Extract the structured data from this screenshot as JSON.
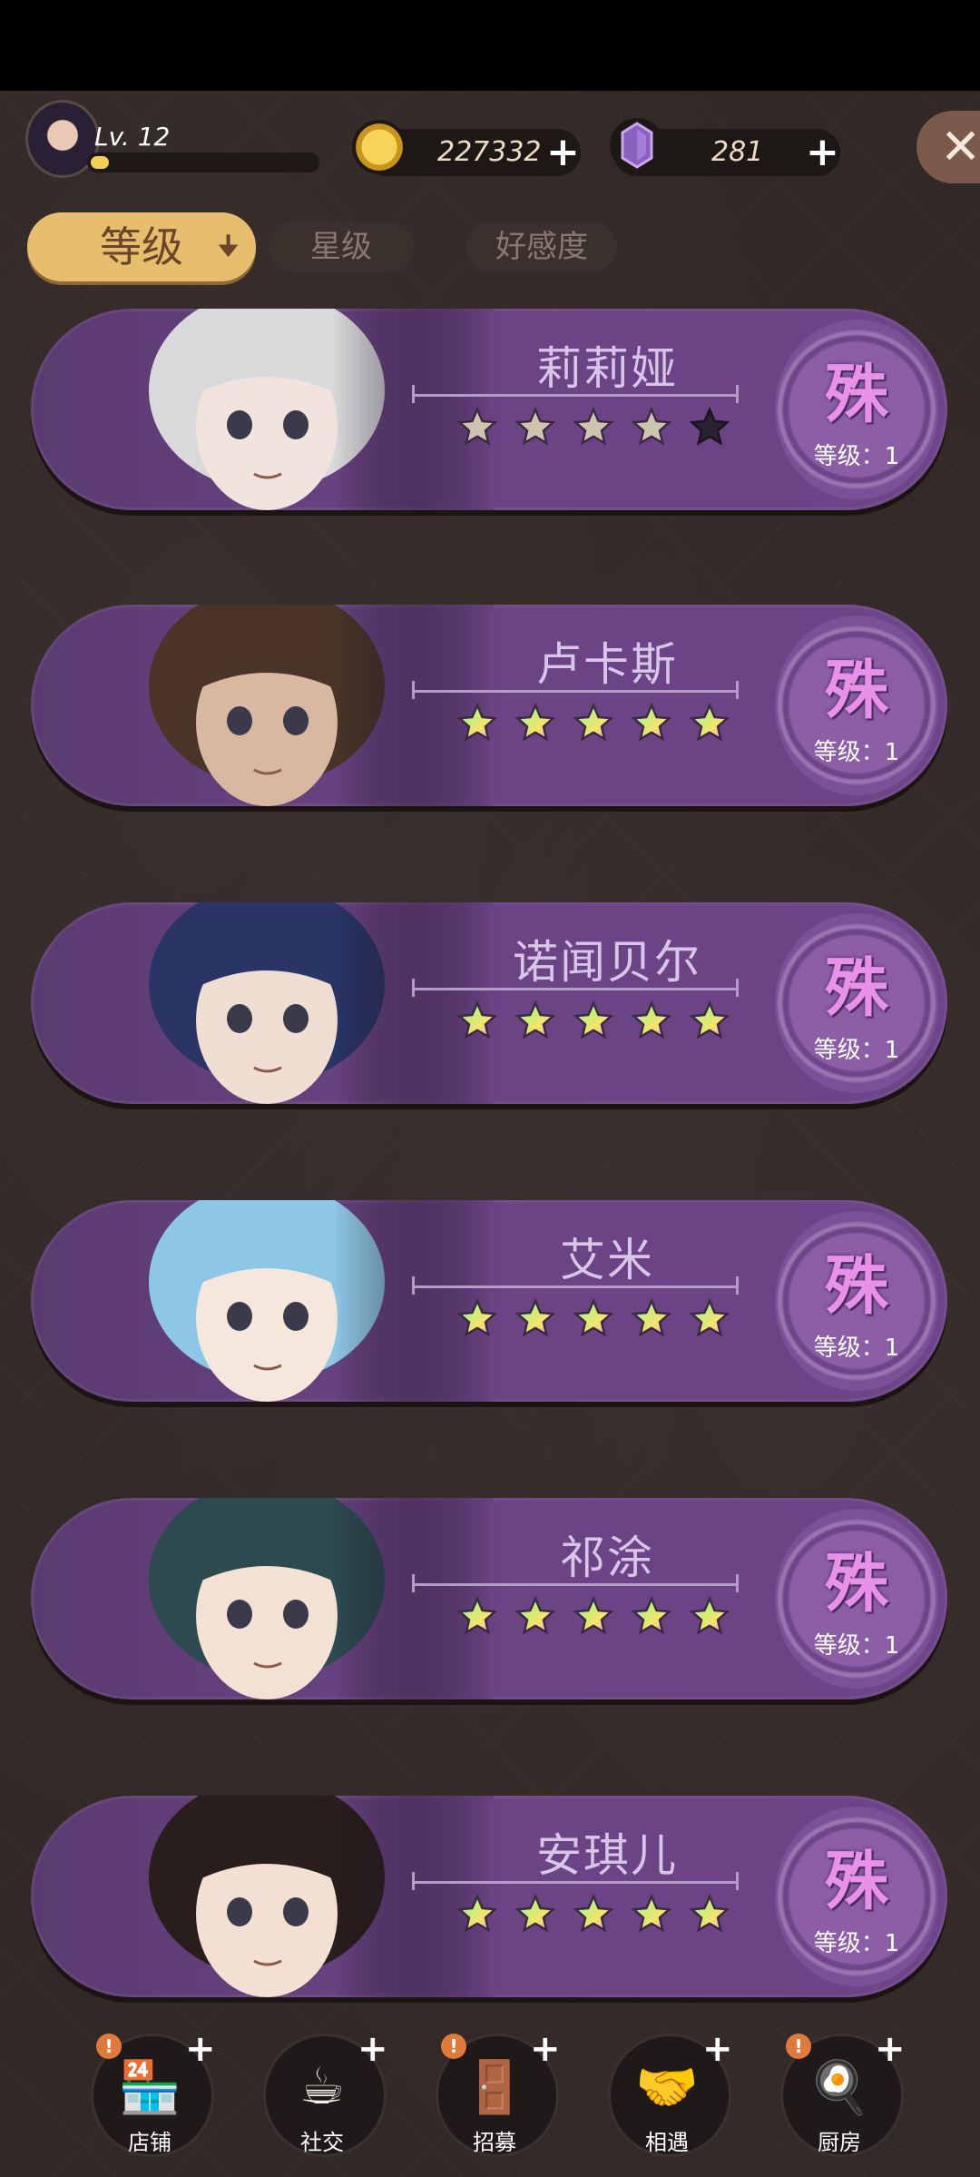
{
  "player": {
    "level_label": "Lv. 12",
    "exp_fraction": 0.08
  },
  "resources": {
    "coins": "227332",
    "gems": "281"
  },
  "sort_tabs": [
    {
      "label": "等级",
      "active": true
    },
    {
      "label": "星级",
      "active": false
    },
    {
      "label": "好感度",
      "active": false
    }
  ],
  "characters": [
    {
      "name": "莉莉娅",
      "stars_filled": 4,
      "stars_total": 5,
      "badge": "殊",
      "level": "等级：1",
      "hair": "#d9d9dc",
      "skin": "#f1e4de"
    },
    {
      "name": "卢卡斯",
      "stars_filled": 5,
      "stars_total": 5,
      "badge": "殊",
      "level": "等级：1",
      "hair": "#4a3428",
      "skin": "#d8b8a0"
    },
    {
      "name": "诺闻贝尔",
      "stars_filled": 5,
      "stars_total": 5,
      "badge": "殊",
      "level": "等级：1",
      "hair": "#2a3566",
      "skin": "#f1ded3"
    },
    {
      "name": "艾米",
      "stars_filled": 5,
      "stars_total": 5,
      "badge": "殊",
      "level": "等级：1",
      "hair": "#8ec7e6",
      "skin": "#f5e7dc"
    },
    {
      "name": "祁涂",
      "stars_filled": 5,
      "stars_total": 5,
      "badge": "殊",
      "level": "等级：1",
      "hair": "#2d4a50",
      "skin": "#f3e2d4"
    },
    {
      "name": "安琪儿",
      "stars_filled": 5,
      "stars_total": 5,
      "badge": "殊",
      "level": "等级：1",
      "hair": "#2a1e1c",
      "skin": "#f4e0d2"
    }
  ],
  "bottom_nav": [
    {
      "label": "店铺",
      "icon": "shop-icon",
      "glyph": "🏪",
      "alert": true
    },
    {
      "label": "社交",
      "icon": "coffee-icon",
      "glyph": "☕",
      "alert": false
    },
    {
      "label": "招募",
      "icon": "door-icon",
      "glyph": "🚪",
      "alert": true
    },
    {
      "label": "相遇",
      "icon": "handshake-icon",
      "glyph": "🤝",
      "alert": false
    },
    {
      "label": "厨房",
      "icon": "pan-icon",
      "glyph": "🍳",
      "alert": true
    }
  ],
  "alert_mark": "!",
  "plus_mark": "+",
  "close_mark": "✕",
  "sort_arrow": "🠋",
  "colors": {
    "card": "#6a4383",
    "accent_gold": "#e6be6e",
    "badge_text": "#e891e9",
    "star_empty": "#2b2230"
  }
}
